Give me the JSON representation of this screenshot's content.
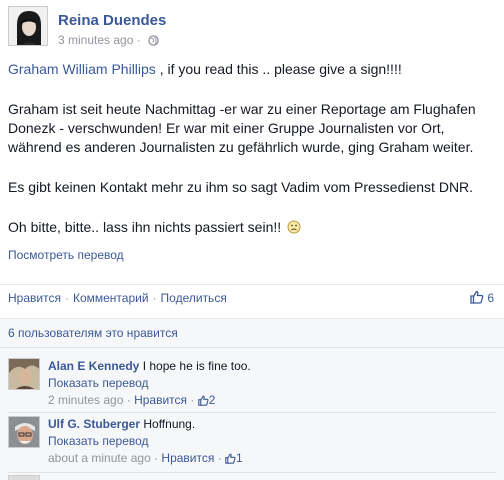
{
  "post": {
    "author": "Reina Duendes",
    "time": "3 minutes ago",
    "privacy_icon": "globe-icon",
    "mention": "Graham William Phillips",
    "line1_rest": " , if you read this .. please give a sign!!!!",
    "paragraph2": "Graham ist seit heute Nachmittag -er war zu einer Reportage am Flughafen Donezk - verschwunden! Er war mit einer Gruppe Journalisten vor Ort, während es anderen Journalisten zu gefährlich wurde, ging Graham weiter.",
    "paragraph3": "Es gibt keinen Kontakt mehr zu ihm so sagt Vadim vom Pressedienst DNR.",
    "paragraph4": "Oh bitte, bitte.. lass ihn nichts passiert sein!!",
    "emoji": "sad-face-icon",
    "see_translation": "Посмотреть перевод"
  },
  "actions": {
    "like": "Нравится",
    "comment": "Комментарий",
    "share": "Поделиться",
    "sep": "·",
    "like_count": "6"
  },
  "likes_summary": "6 пользователям это нравится",
  "comments": [
    {
      "author": "Alan E Kennedy",
      "text": " I hope he is fine too.",
      "translate": "Показать перевод",
      "time": "2 minutes ago",
      "like_label": "Нравится",
      "like_count": "2"
    },
    {
      "author": "Ulf G. Stuberger",
      "text": " Hoffnung.",
      "translate": "Показать перевод",
      "time": "about a minute ago",
      "like_label": "Нравится",
      "like_count": "1"
    }
  ],
  "colors": {
    "link": "#3b5998",
    "meta": "#90949c",
    "comment_bg": "#f6f7f9"
  }
}
